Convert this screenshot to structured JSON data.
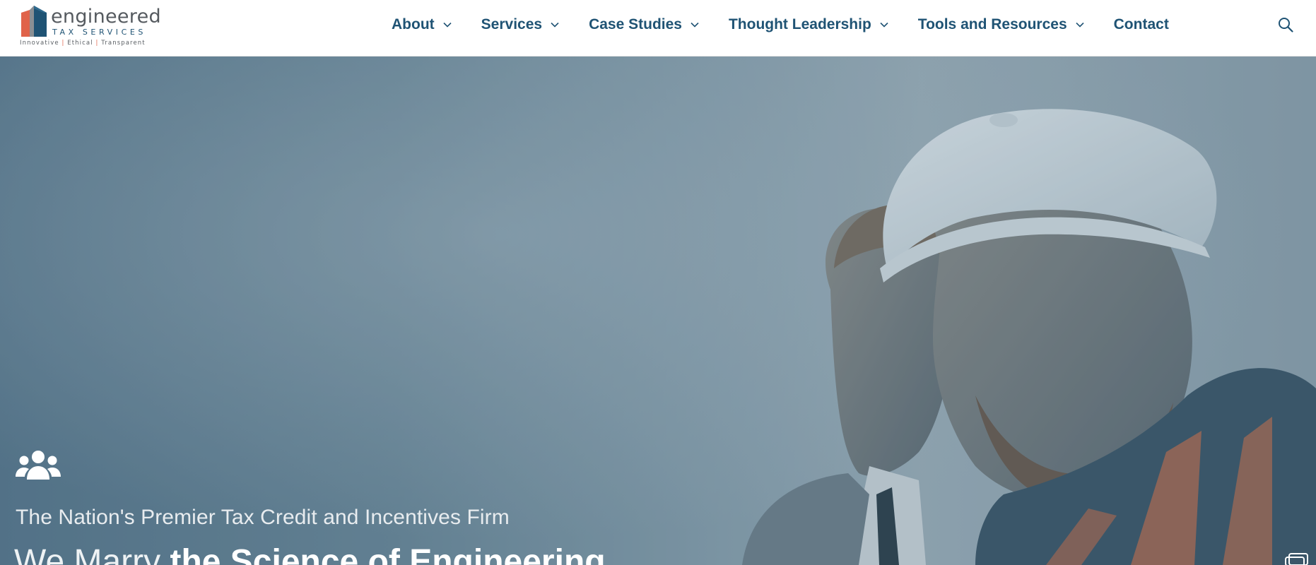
{
  "brand": {
    "name": "engineered",
    "sub": "TAX SERVICES",
    "tagline_parts": [
      "Innovative",
      "Ethical",
      "Transparent"
    ],
    "separator": "|"
  },
  "nav": {
    "items": [
      {
        "label": "About",
        "has_dropdown": true
      },
      {
        "label": "Services",
        "has_dropdown": true
      },
      {
        "label": "Case Studies",
        "has_dropdown": true
      },
      {
        "label": "Thought Leadership",
        "has_dropdown": true
      },
      {
        "label": "Tools and Resources",
        "has_dropdown": true
      },
      {
        "label": "Contact",
        "has_dropdown": false
      }
    ],
    "search_icon": "search-icon"
  },
  "hero": {
    "icon": "users-icon",
    "tagline": "The Nation's Premier Tax Credit and Incentives Firm",
    "headline_light": "We Marry ",
    "headline_bold": "the Science of Engineering"
  },
  "colors": {
    "brand_blue": "#1f5374",
    "brand_orange": "#e0634a",
    "hero_tint": "#5e7d91"
  }
}
